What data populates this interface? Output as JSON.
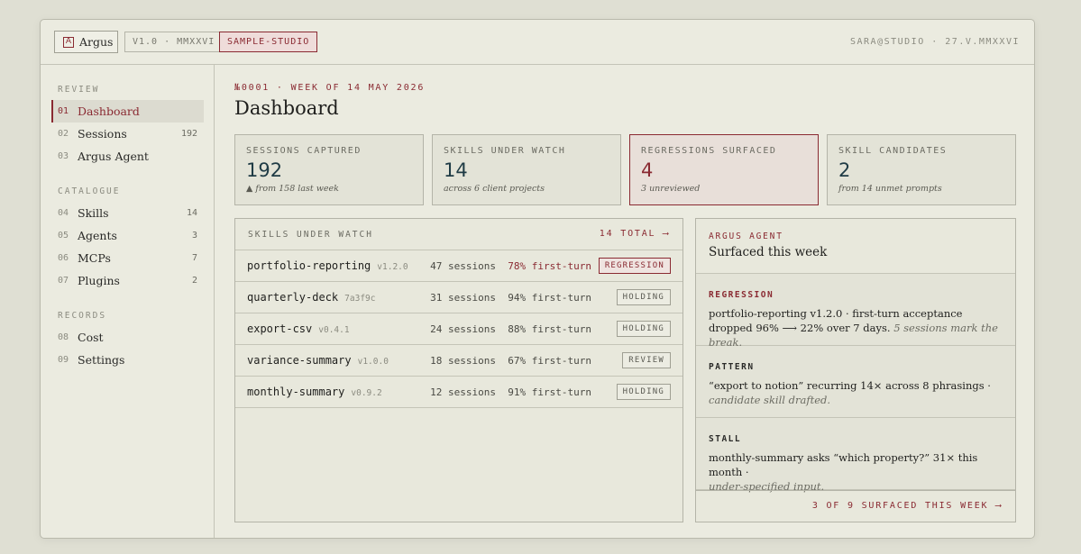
{
  "app": {
    "name": "Argus",
    "logo_glyph": "A",
    "version": "V1.0 · MMXXVI",
    "workspace": "SAMPLE-STUDIO",
    "user_date": "SARA@STUDIO · 27.V.MMXXVI"
  },
  "sidebar": {
    "sections": [
      {
        "label": "REVIEW",
        "items": [
          {
            "num": "01",
            "label": "Dashboard",
            "count": "",
            "active": true
          },
          {
            "num": "02",
            "label": "Sessions",
            "count": "192"
          },
          {
            "num": "03",
            "label": "Argus Agent",
            "count": ""
          }
        ]
      },
      {
        "label": "CATALOGUE",
        "items": [
          {
            "num": "04",
            "label": "Skills",
            "count": "14"
          },
          {
            "num": "05",
            "label": "Agents",
            "count": "3"
          },
          {
            "num": "06",
            "label": "MCPs",
            "count": "7"
          },
          {
            "num": "07",
            "label": "Plugins",
            "count": "2"
          }
        ]
      },
      {
        "label": "RECORDS",
        "items": [
          {
            "num": "08",
            "label": "Cost",
            "count": ""
          },
          {
            "num": "09",
            "label": "Settings",
            "count": ""
          }
        ]
      }
    ]
  },
  "header": {
    "eyebrow": "№0001 · WEEK OF 14 MAY 2026",
    "title": "Dashboard"
  },
  "stats": [
    {
      "label": "SESSIONS CAPTURED",
      "value": "192",
      "sub": "▲ from 158 last week"
    },
    {
      "label": "SKILLS UNDER WATCH",
      "value": "14",
      "sub": "across 6 client projects"
    },
    {
      "label": "REGRESSIONS SURFACED",
      "value": "4",
      "sub": "3 unreviewed"
    },
    {
      "label": "SKILL CANDIDATES",
      "value": "2",
      "sub": "from 14 unmet prompts"
    }
  ],
  "skills_panel": {
    "title": "SKILLS UNDER WATCH",
    "link": "14 TOTAL ⟶",
    "rows": [
      {
        "name": "portfolio-reporting",
        "version": "v1.2.0",
        "sessions": "47 sessions",
        "pct": "78% first-turn",
        "tag": "REGRESSION"
      },
      {
        "name": "quarterly-deck",
        "version": "7a3f9c",
        "sessions": "31 sessions",
        "pct": "94% first-turn",
        "tag": "HOLDING"
      },
      {
        "name": "export-csv",
        "version": "v0.4.1",
        "sessions": "24 sessions",
        "pct": "88% first-turn",
        "tag": "HOLDING"
      },
      {
        "name": "variance-summary",
        "version": "v1.0.0",
        "sessions": "18 sessions",
        "pct": "67% first-turn",
        "tag": "REVIEW"
      },
      {
        "name": "monthly-summary",
        "version": "v0.9.2",
        "sessions": "12 sessions",
        "pct": "91% first-turn",
        "tag": "HOLDING"
      }
    ]
  },
  "agent_panel": {
    "eyebrow": "ARGUS AGENT",
    "title": "Surfaced this week",
    "items": [
      {
        "kind": "REGRESSION",
        "text": "portfolio-reporting v1.2.0 · first-turn acceptance dropped 96% ⟶ 22% over 7 days.",
        "note": "5 sessions mark the break."
      },
      {
        "kind": "PATTERN",
        "text": "“export to notion” recurring 14× across 8 phrasings ·",
        "note": "candidate skill drafted."
      },
      {
        "kind": "STALL",
        "text": "monthly-summary asks “which property?” 31× this month ·",
        "note": "under-specified input."
      }
    ],
    "footer": "3 OF 9 SURFACED THIS WEEK ⟶"
  },
  "colors": {
    "accent": "#8a2a32",
    "background": "#dfdfd3",
    "surface": "#ebebe0",
    "value": "#1f3b45"
  }
}
